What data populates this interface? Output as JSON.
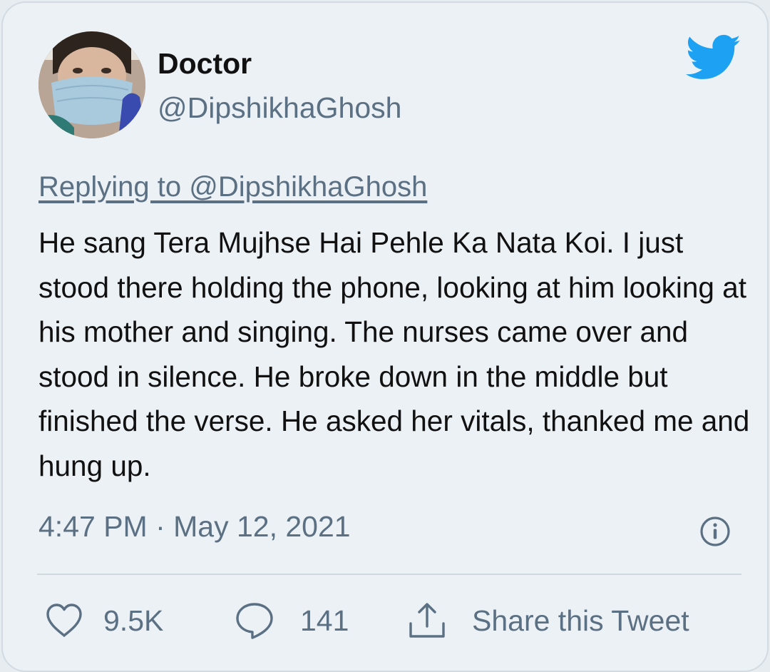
{
  "tweet": {
    "display_name": "Doctor",
    "handle": "@DipshikhaGhosh",
    "replying_to": "Replying to @DipshikhaGhosh",
    "text": "He sang Tera Mujhse Hai Pehle Ka Nata Koi. I just stood there holding the phone, looking at him looking at his mother and singing. The nurses came over and stood in silence. He broke down in the middle but finished the verse. He asked her vitals, thanked me and hung up.",
    "timestamp": "4:47 PM · May 12, 2021"
  },
  "actions": {
    "like_count": "9.5K",
    "reply_count": "141",
    "share_label": "Share this Tweet"
  },
  "icons": {
    "brand": "twitter-bird-icon",
    "info": "info-icon",
    "like": "heart-icon",
    "reply": "speech-bubble-icon",
    "share": "share-upload-icon"
  },
  "colors": {
    "brand_blue": "#1da1f2",
    "secondary_text": "#5b7083",
    "primary_text": "#111111",
    "card_background": "#ecf1f5"
  }
}
